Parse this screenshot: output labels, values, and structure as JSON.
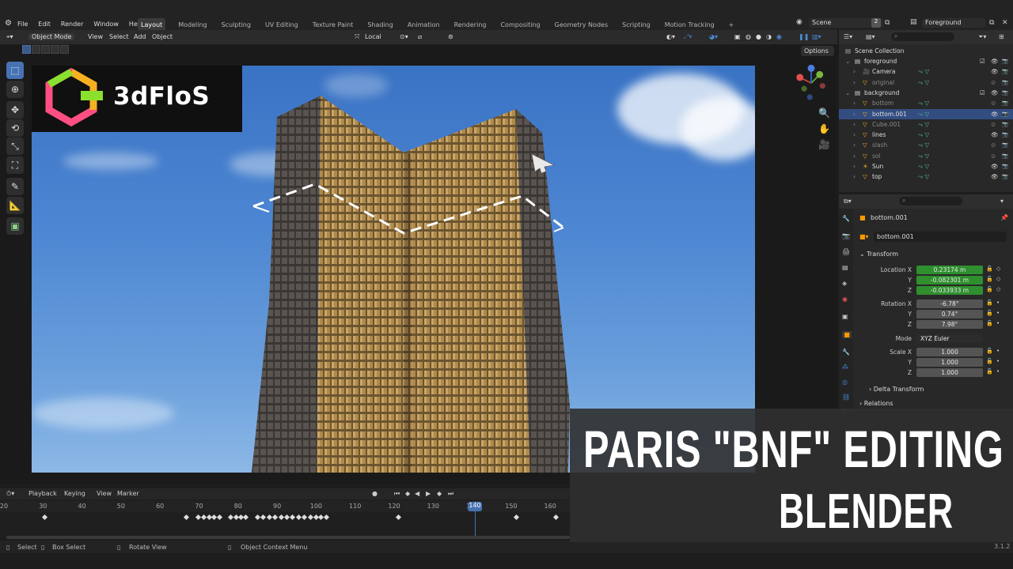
{
  "menu": [
    "File",
    "Edit",
    "Render",
    "Window",
    "Help"
  ],
  "workspaces": [
    "Layout",
    "Modeling",
    "Sculpting",
    "UV Editing",
    "Texture Paint",
    "Shading",
    "Animation",
    "Rendering",
    "Compositing",
    "Geometry Nodes",
    "Scripting",
    "Motion Tracking",
    "+"
  ],
  "active_workspace": "Layout",
  "scene": {
    "label": "Scene",
    "users": "2",
    "view_layer": "Foreground"
  },
  "viewport_header": {
    "mode": "Object Mode",
    "view": "View",
    "select": "Select",
    "add": "Add",
    "object": "Object",
    "transform_orientation": "Local",
    "options": "Options"
  },
  "logo": {
    "text": "3dFloS"
  },
  "timeline": {
    "playback": "Playback",
    "keying": "Keying",
    "view": "View",
    "marker": "Marker",
    "ruler": [
      "20",
      "30",
      "40",
      "50",
      "60",
      "70",
      "80",
      "90",
      "100",
      "110",
      "120",
      "130",
      "140",
      "150",
      "160"
    ],
    "current_frame": "140"
  },
  "statusbar": {
    "select": "Select",
    "box_select": "Box Select",
    "rotate_view": "Rotate View",
    "context_menu": "Object Context Menu",
    "version": "3.1.2"
  },
  "outliner": {
    "root": "Scene Collection",
    "rows": [
      {
        "name": "foreground",
        "indent": 1,
        "dim": false,
        "sel": false
      },
      {
        "name": "Camera",
        "indent": 2,
        "dim": false,
        "sel": false
      },
      {
        "name": "original",
        "indent": 2,
        "dim": true,
        "sel": false
      },
      {
        "name": "background",
        "indent": 1,
        "dim": false,
        "sel": false
      },
      {
        "name": "bottom",
        "indent": 2,
        "dim": true,
        "sel": false
      },
      {
        "name": "bottom.001",
        "indent": 2,
        "dim": false,
        "sel": true
      },
      {
        "name": "Cube.001",
        "indent": 2,
        "dim": true,
        "sel": false
      },
      {
        "name": "lines",
        "indent": 2,
        "dim": false,
        "sel": false
      },
      {
        "name": "slash",
        "indent": 2,
        "dim": true,
        "sel": false
      },
      {
        "name": "sol",
        "indent": 2,
        "dim": true,
        "sel": false
      },
      {
        "name": "Sun",
        "indent": 2,
        "dim": false,
        "sel": false
      },
      {
        "name": "top",
        "indent": 2,
        "dim": false,
        "sel": false
      }
    ]
  },
  "properties": {
    "object_name": "bottom.001",
    "object_field": "bottom.001",
    "transform": "Transform",
    "location": {
      "label": "Location X",
      "x": "0.23174 m",
      "y": "-0.082301 m",
      "z": "-0.033933 m"
    },
    "rotation": {
      "label": "Rotation X",
      "x": "-6.78°",
      "y": "0.74°",
      "z": "7.98°"
    },
    "mode": {
      "label": "Mode",
      "value": "XYZ Euler"
    },
    "scale": {
      "label": "Scale X",
      "x": "1.000",
      "y": "1.000",
      "z": "1.000"
    },
    "axis_y": "Y",
    "axis_z": "Z",
    "delta_transform": "Delta Transform",
    "relations": "Relations"
  },
  "overlay": {
    "line1": "PARIS \"BNF\" EDITING",
    "line2": "BLENDER"
  },
  "colors": {
    "accent": "#4772b3",
    "selected_row": "#334d80",
    "location_field": "#2f8f2f"
  }
}
